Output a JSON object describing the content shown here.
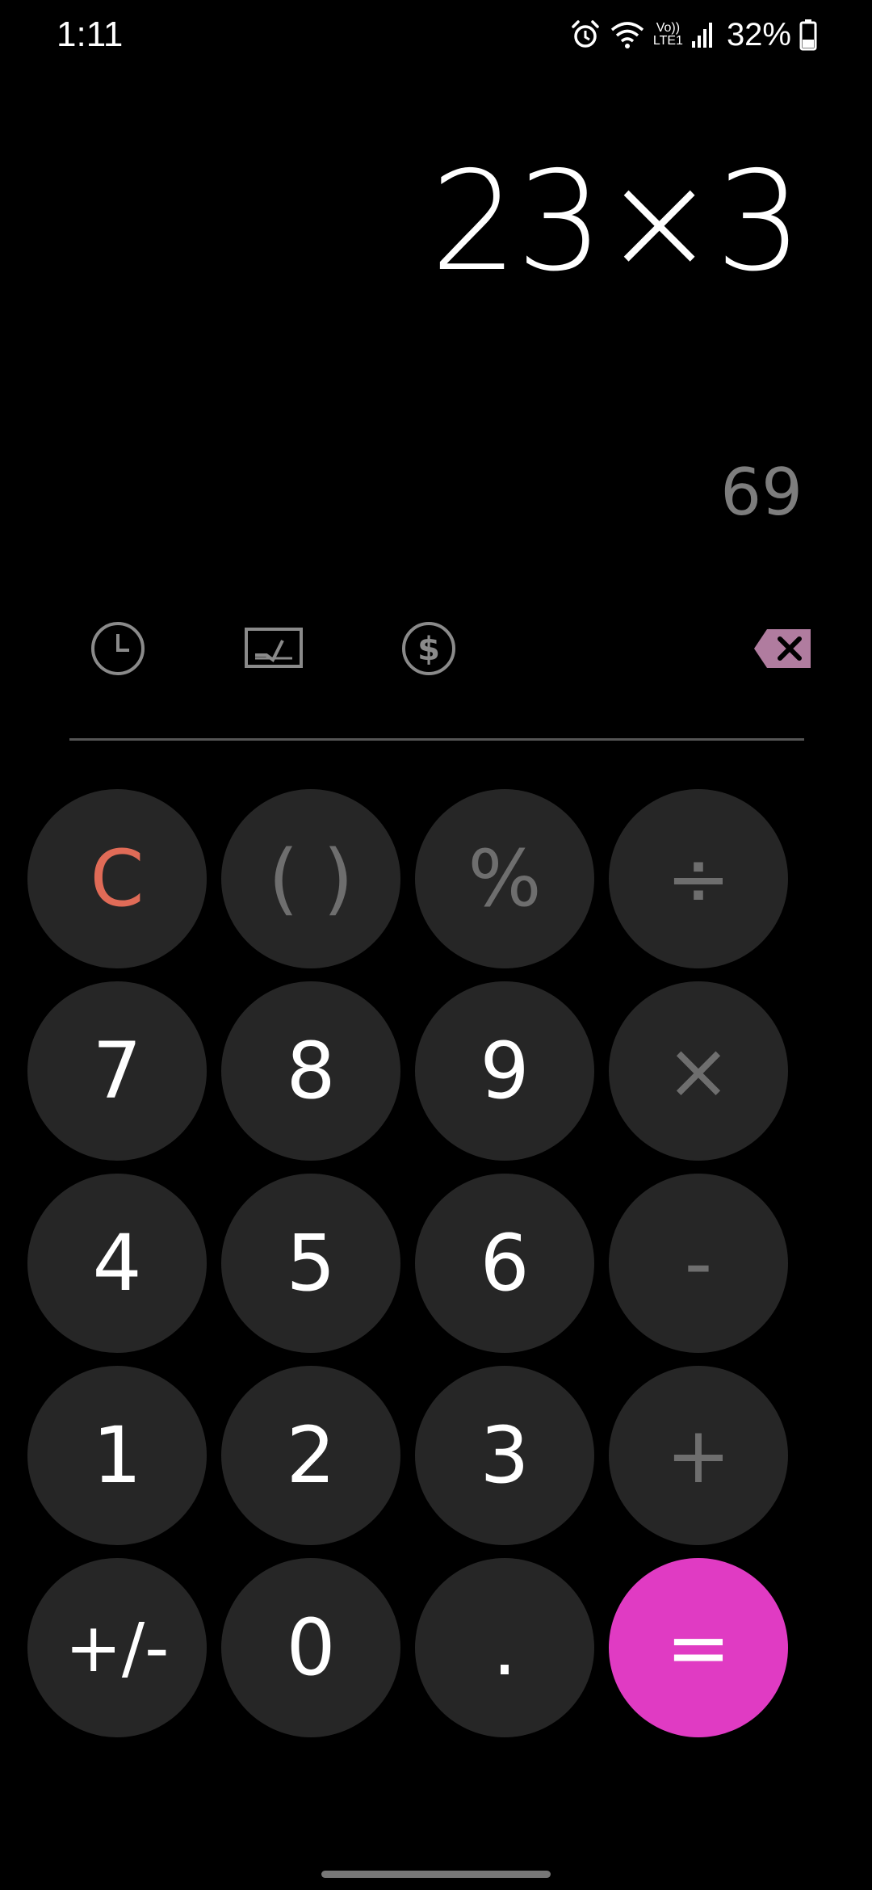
{
  "status_bar": {
    "time": "1:11",
    "network_label": "LTE1",
    "volte_label": "Vo))",
    "battery_percent": "32%"
  },
  "display": {
    "expression": "23×3",
    "result_preview": "69"
  },
  "toolbar": {
    "history_icon": "clock-icon",
    "unit_converter_icon": "ruler-chart-icon",
    "currency_icon": "dollar-icon",
    "backspace_icon": "backspace-icon"
  },
  "keys": {
    "clear": "C",
    "parentheses": "( )",
    "percent": "%",
    "divide": "÷",
    "seven": "7",
    "eight": "8",
    "nine": "9",
    "multiply": "×",
    "four": "4",
    "five": "5",
    "six": "6",
    "minus": "-",
    "one": "1",
    "two": "2",
    "three": "3",
    "plus": "+",
    "plus_minus": "+/-",
    "zero": "0",
    "decimal": ".",
    "equals": "="
  },
  "colors": {
    "background": "#000000",
    "key_background": "#262626",
    "operator_text": "#6e6e6e",
    "clear_text": "#e06b57",
    "equals_background": "#e03bc3",
    "backspace_badge": "#b07c9f",
    "preview_text": "#7d7d7d"
  }
}
